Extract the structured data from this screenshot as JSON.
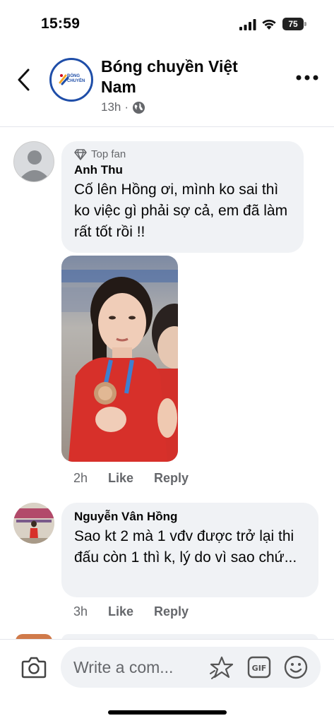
{
  "status_bar": {
    "time": "15:59",
    "battery": "75",
    "battery_level": 0.75
  },
  "header": {
    "page_name": "Bóng chuyền Việt Nam",
    "post_age": "13h",
    "separator": "·",
    "logo_text": "BÓNG CHUYỀN"
  },
  "comments": [
    {
      "badge": "Top fan",
      "name": "Anh Thu",
      "text": "Cố lên Hồng ơi, mình ko sai thì ko việc gì phải sợ cả, em đã làm rất tốt rồi !!",
      "time": "2h",
      "like_label": "Like",
      "reply_label": "Reply"
    },
    {
      "name": "Nguyễn Vân Hồng",
      "text": "Sao kt 2 mà 1 vđv được trở lại thi đấu còn 1 thì k, lý do vì sao chứ...",
      "time": "3h",
      "like_label": "Like",
      "reply_label": "Reply"
    }
  ],
  "composer": {
    "placeholder": "Write a com..."
  },
  "colors": {
    "brand_blue": "#1f4ea8",
    "bubble_bg": "#f0f2f5",
    "secondary_text": "#65676b"
  }
}
